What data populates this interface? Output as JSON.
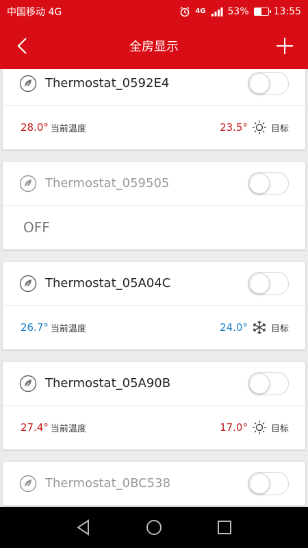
{
  "status_bar": {
    "carrier": "中国移动 4G",
    "network_small": "4G",
    "battery_percent": "53%",
    "battery_level": 0.53,
    "time": "13:55"
  },
  "nav": {
    "title": "全房显示"
  },
  "devices": [
    {
      "name": "Thermostat_0592E4",
      "online": true,
      "current_temp": "28.0°",
      "current_label": "当前温度",
      "target_temp": "23.5°",
      "target_label": "目标",
      "mode_icon": "sun-icon",
      "temp_color": "#c41a1a"
    },
    {
      "name": "Thermostat_059505",
      "online": false,
      "off_text": "OFF"
    },
    {
      "name": "Thermostat_05A04C",
      "online": true,
      "current_temp": "26.7°",
      "current_label": "当前温度",
      "target_temp": "24.0°",
      "target_label": "目标",
      "mode_icon": "snowflake-icon",
      "temp_color": "#1a7fc4"
    },
    {
      "name": "Thermostat_05A90B",
      "online": true,
      "current_temp": "27.4°",
      "current_label": "当前温度",
      "target_temp": "17.0°",
      "target_label": "目标",
      "mode_icon": "sun-icon",
      "temp_color": "#c41a1a"
    },
    {
      "name": "Thermostat_0BC538",
      "online": false
    }
  ],
  "colors": {
    "brand_red": "#d90d15",
    "heat": "#c41a1a",
    "cool": "#1a7fc4"
  }
}
